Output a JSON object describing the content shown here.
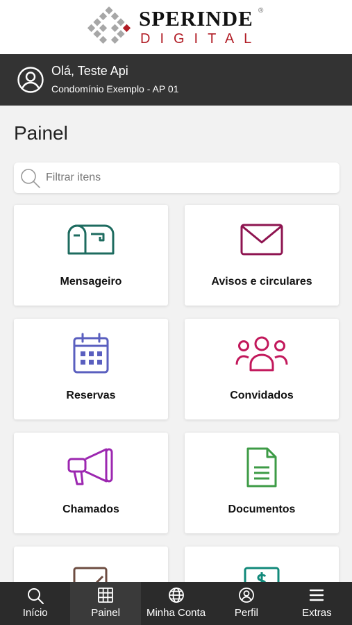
{
  "logo": {
    "brand": "SPERINDE",
    "reg": "®",
    "sub": "DIGITAL",
    "accent_color": "#b11c25"
  },
  "header": {
    "greeting": "Olá, Teste Api",
    "unit": "Condomínio Exemplo - AP 01"
  },
  "page": {
    "title": "Painel"
  },
  "search": {
    "placeholder": "Filtrar itens"
  },
  "cards": [
    {
      "label": "Mensageiro",
      "icon": "mailbox-icon",
      "color": "#1d6b5f"
    },
    {
      "label": "Avisos e circulares",
      "icon": "envelope-icon",
      "color": "#8e1450"
    },
    {
      "label": "Reservas",
      "icon": "calendar-icon",
      "color": "#5a5fbf"
    },
    {
      "label": "Convidados",
      "icon": "group-icon",
      "color": "#c2185b"
    },
    {
      "label": "Chamados",
      "icon": "megaphone-icon",
      "color": "#9c27b0"
    },
    {
      "label": "Documentos",
      "icon": "document-icon",
      "color": "#3d9b46"
    },
    {
      "label": "",
      "icon": "edit-icon",
      "color": "#6d4c41"
    },
    {
      "label": "",
      "icon": "billing-icon",
      "color": "#11897a"
    }
  ],
  "nav": [
    {
      "label": "Início",
      "icon": "search-icon"
    },
    {
      "label": "Painel",
      "icon": "grid-icon",
      "active": true
    },
    {
      "label": "Minha Conta",
      "icon": "globe-icon"
    },
    {
      "label": "Perfil",
      "icon": "user-circle-icon"
    },
    {
      "label": "Extras",
      "icon": "menu-icon"
    }
  ]
}
